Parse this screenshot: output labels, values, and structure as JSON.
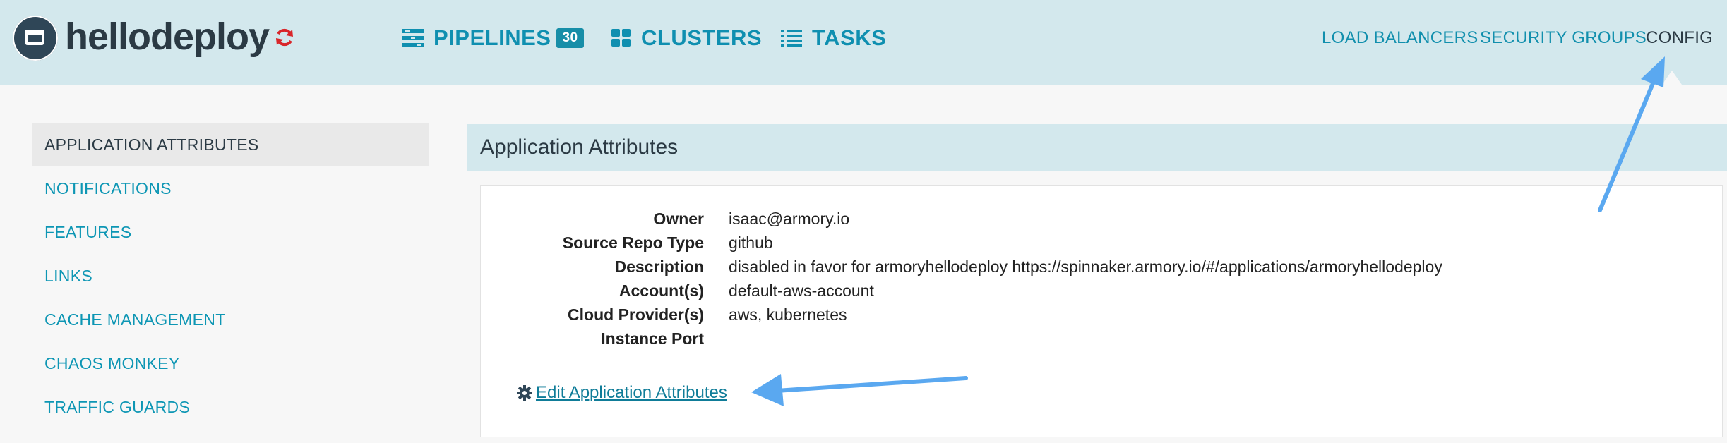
{
  "header": {
    "app_name": "hellodeploy",
    "nav": [
      {
        "label": "PIPELINES",
        "badge": "30",
        "icon": "pipelines-icon"
      },
      {
        "label": "CLUSTERS",
        "icon": "clusters-icon"
      },
      {
        "label": "TASKS",
        "icon": "tasks-icon"
      }
    ],
    "right_nav": [
      "LOAD BALANCERS",
      "SECURITY GROUPS",
      "CONFIG"
    ]
  },
  "sidebar": {
    "items": [
      {
        "label": "APPLICATION ATTRIBUTES",
        "active": true
      },
      {
        "label": "NOTIFICATIONS"
      },
      {
        "label": "FEATURES"
      },
      {
        "label": "LINKS"
      },
      {
        "label": "CACHE MANAGEMENT"
      },
      {
        "label": "CHAOS MONKEY"
      },
      {
        "label": "TRAFFIC GUARDS"
      }
    ]
  },
  "main": {
    "title": "Application Attributes",
    "attributes": [
      {
        "label": "Owner",
        "value": "isaac@armory.io"
      },
      {
        "label": "Source Repo Type",
        "value": "github"
      },
      {
        "label": "Description",
        "value": "disabled in favor for armoryhellodeploy https://spinnaker.armory.io/#/applications/armoryhellodeploy"
      },
      {
        "label": "Account(s)",
        "value": "default-aws-account"
      },
      {
        "label": "Cloud Provider(s)",
        "value": "aws, kubernetes"
      },
      {
        "label": "Instance Port",
        "value": ""
      }
    ],
    "edit_link": "Edit Application Attributes"
  },
  "colors": {
    "header_bg": "#d3e8ed",
    "link": "#0d96b4",
    "annotation_arrow": "#5aa8f0"
  }
}
